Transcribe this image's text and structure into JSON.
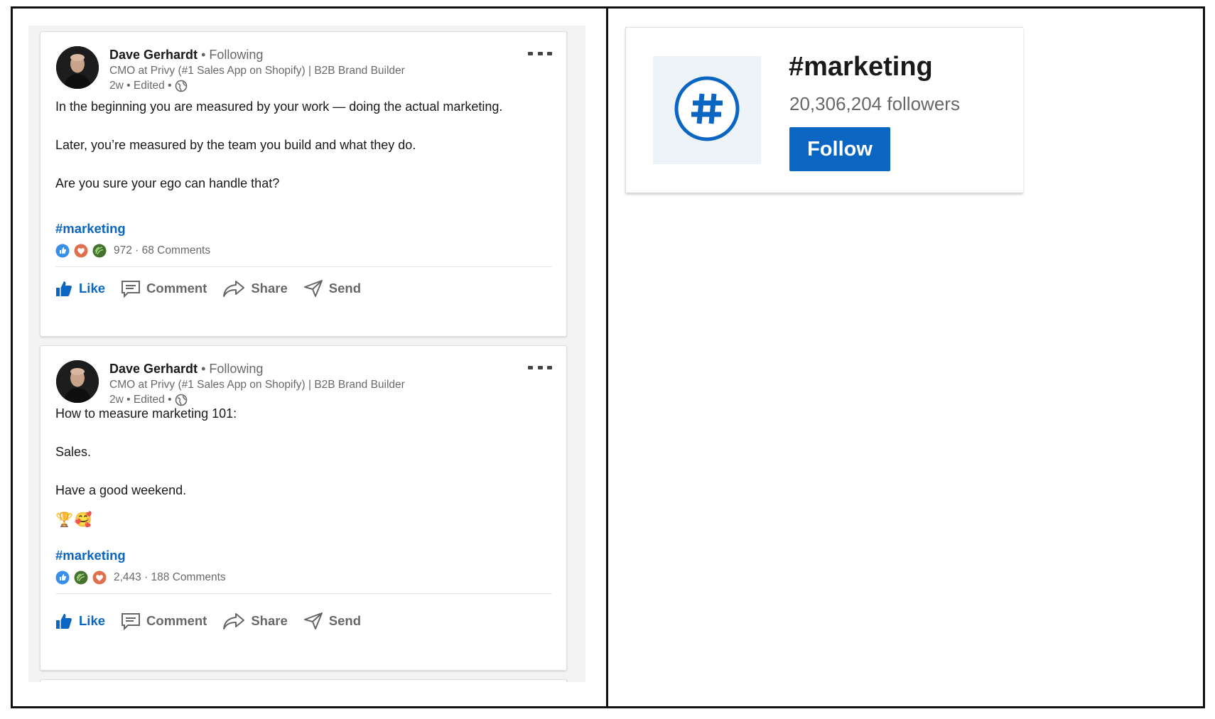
{
  "feed": {
    "posts": [
      {
        "author_name": "Dave Gerhardt",
        "following": "• Following",
        "headline": "CMO at Privy (#1 Sales App on Shopify) | B2B Brand Builder",
        "meta": "2w • Edited •",
        "body": [
          "In the beginning you are measured by your work — doing the actual marketing.",
          "Later, you’re measured by the team you build and what they do.",
          "Are you sure your ego can handle that?"
        ],
        "hashtag": "#marketing",
        "reactions": [
          "like",
          "love",
          "celebrate"
        ],
        "counts": "972 · 68 Comments"
      },
      {
        "author_name": "Dave Gerhardt",
        "following": "• Following",
        "headline": "CMO at Privy (#1 Sales App on Shopify) | B2B Brand Builder",
        "meta": "2w • Edited •",
        "body": [
          "How to measure marketing 101:",
          "Sales.",
          "Have a good weekend."
        ],
        "emoji": [
          "🏆",
          "🥰"
        ],
        "hashtag": "#marketing",
        "reactions": [
          "like",
          "celebrate",
          "love"
        ],
        "counts": "2,443 · 188 Comments"
      }
    ],
    "actions": {
      "like": "Like",
      "comment": "Comment",
      "share": "Share",
      "send": "Send"
    }
  },
  "hashtag_card": {
    "title": "#marketing",
    "followers": "20,306,204 followers",
    "follow_label": "Follow"
  },
  "colors": {
    "accent": "#0a66c2",
    "like_reaction": "#378fe9",
    "love_reaction": "#df704d",
    "celebrate_reaction": "#44712e"
  }
}
